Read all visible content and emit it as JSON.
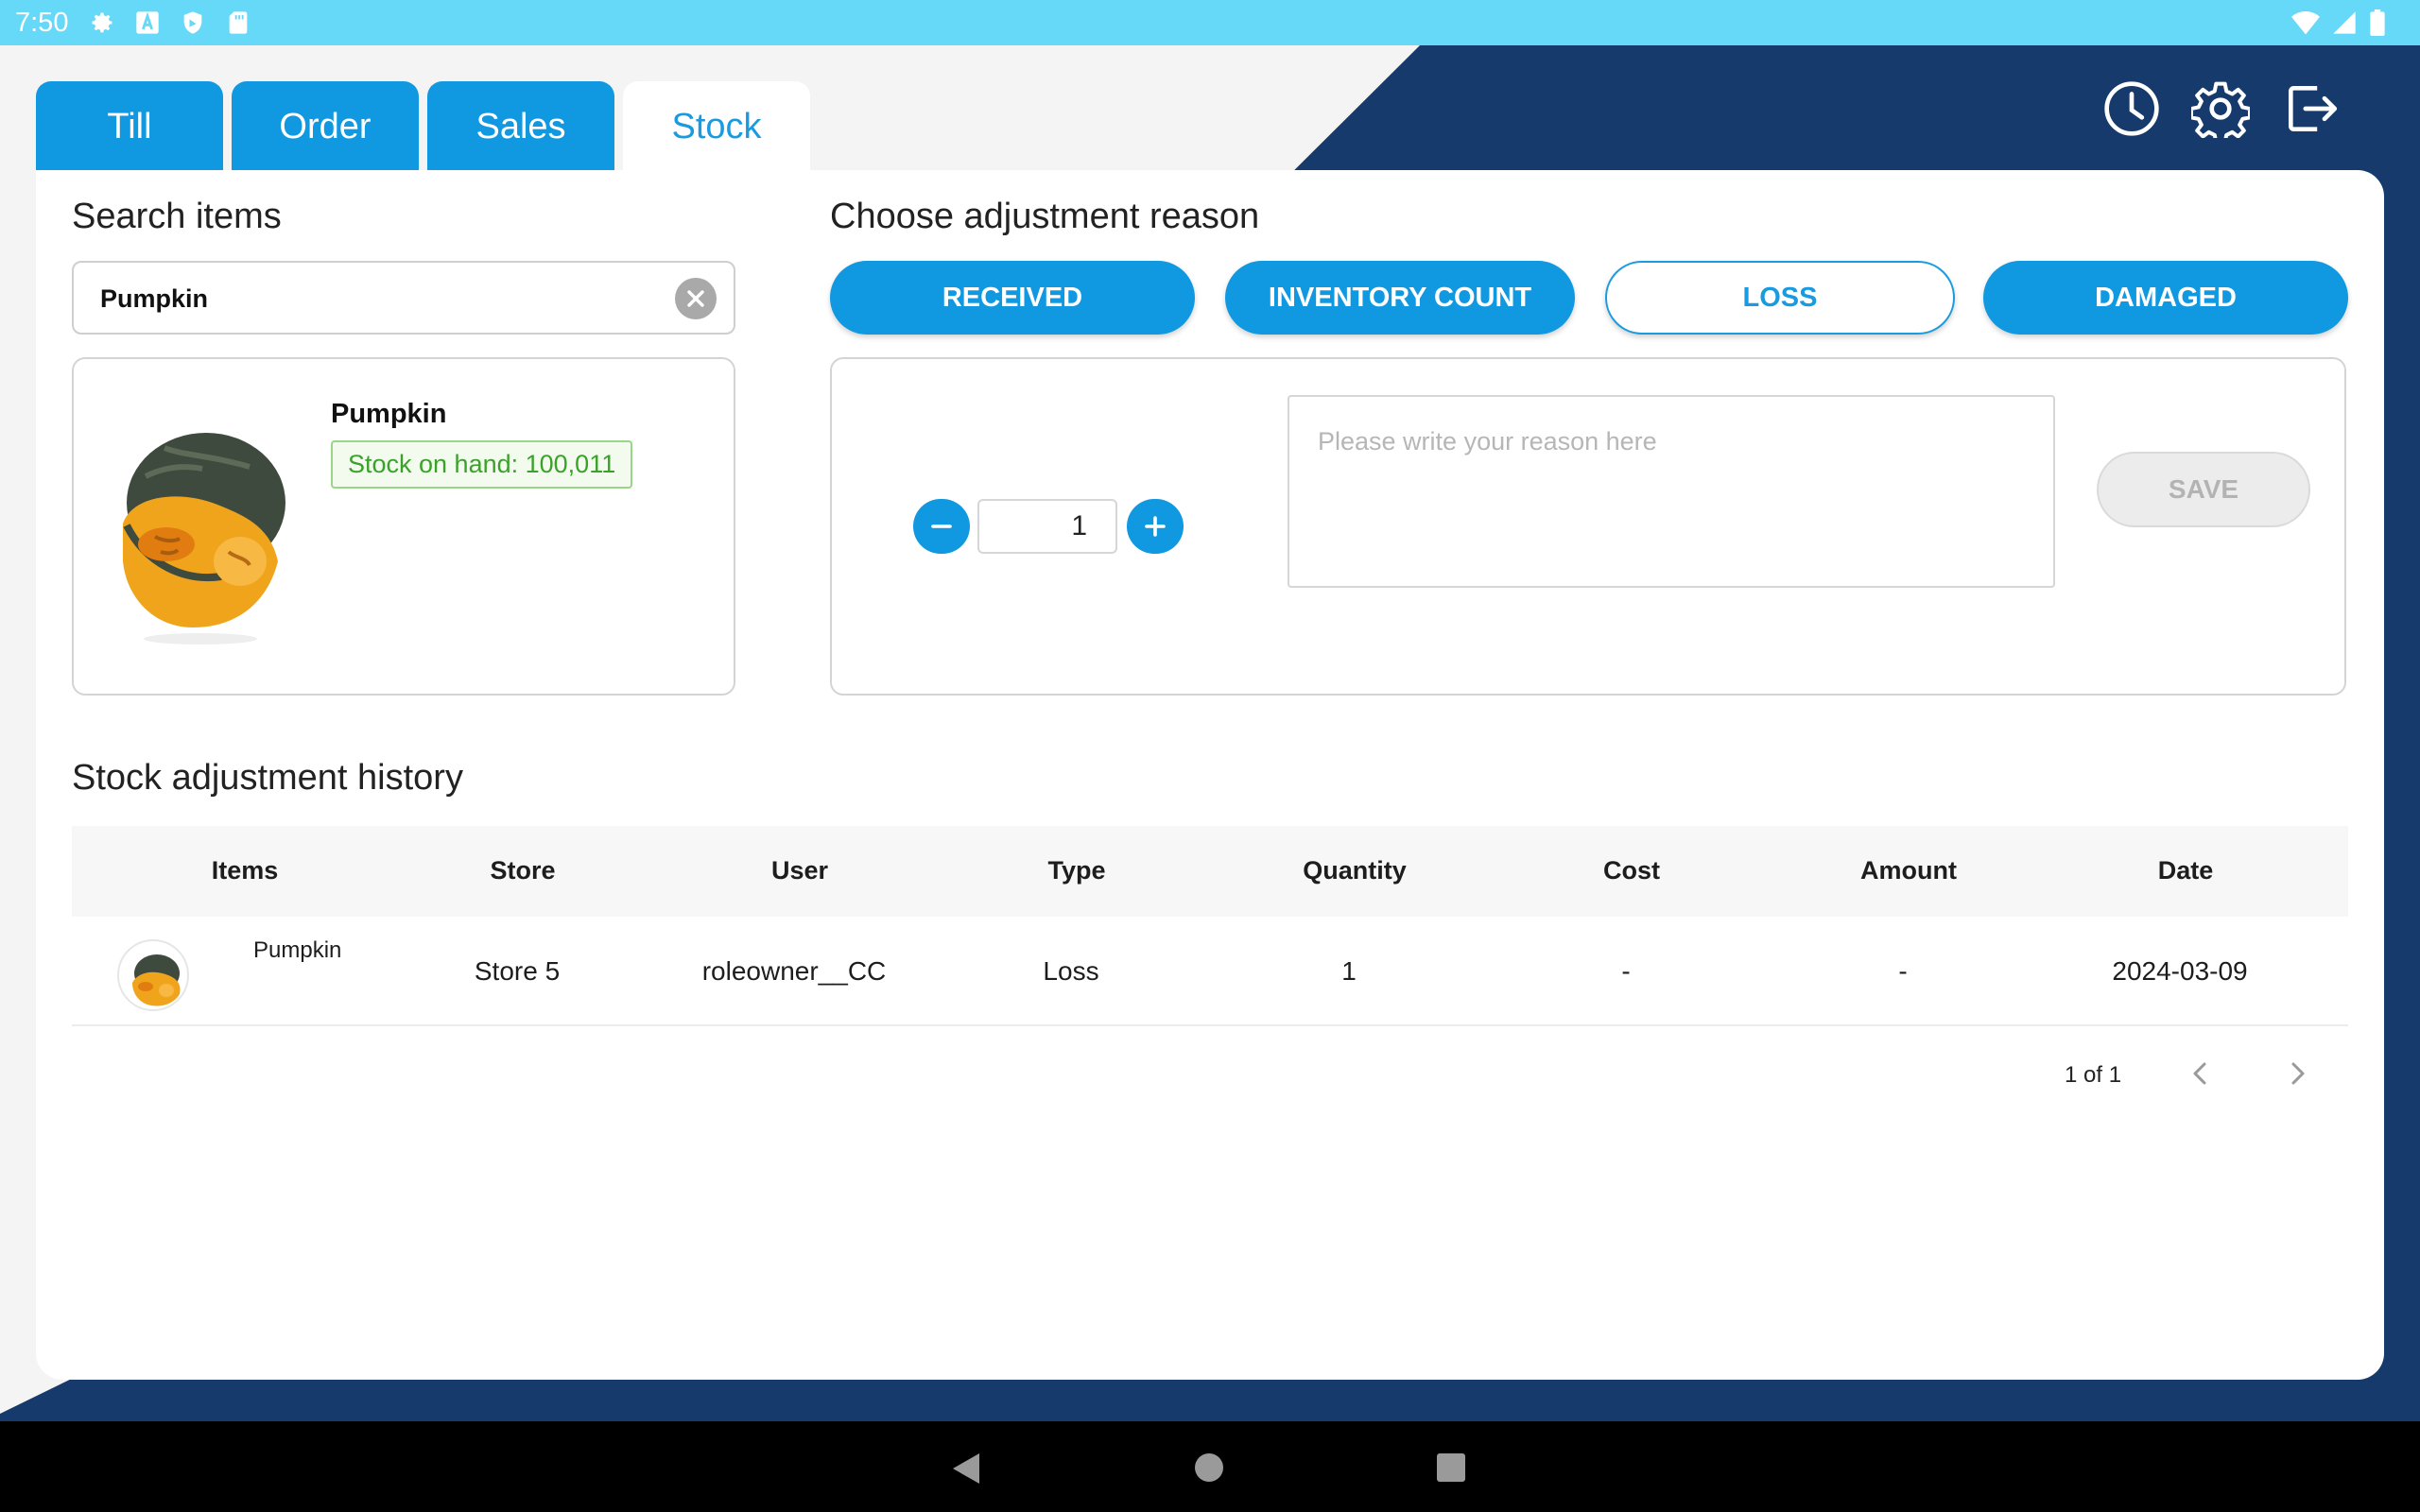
{
  "status_bar": {
    "time": "7:50",
    "icons": [
      "settings-icon",
      "a-badge-icon",
      "shield-icon",
      "sd-card-icon",
      "wifi-icon",
      "signal-icon",
      "battery-icon"
    ]
  },
  "tabs": [
    {
      "label": "Till",
      "active": false
    },
    {
      "label": "Order",
      "active": false
    },
    {
      "label": "Sales",
      "active": false
    },
    {
      "label": "Stock",
      "active": true
    }
  ],
  "toolbar_icons": [
    "history-clock-icon",
    "settings-gear-icon",
    "logout-icon"
  ],
  "search": {
    "title": "Search items",
    "value": "Pumpkin"
  },
  "item": {
    "name": "Pumpkin",
    "stock_label": "Stock on hand: 100,011"
  },
  "adjustment": {
    "title": "Choose adjustment reason",
    "reasons": [
      {
        "label": "RECEIVED",
        "selected": false
      },
      {
        "label": "INVENTORY COUNT",
        "selected": false
      },
      {
        "label": "LOSS",
        "selected": true
      },
      {
        "label": "DAMAGED",
        "selected": false
      }
    ],
    "quantity": "1",
    "reason_placeholder": "Please write your reason here",
    "save_label": "SAVE"
  },
  "history": {
    "title": "Stock adjustment history",
    "columns": [
      "Items",
      "Store",
      "User",
      "Type",
      "Quantity",
      "Cost",
      "Amount",
      "Date"
    ],
    "rows": [
      {
        "item": "Pumpkin",
        "store": "Store 5",
        "user": "roleowner__CC",
        "type": "Loss",
        "quantity": "1",
        "cost": "-",
        "amount": "-",
        "date": "2024-03-09"
      }
    ],
    "pagination": "1 of 1"
  },
  "colors": {
    "primary": "#1098e0",
    "status_bar": "#66d9f8",
    "backdrop": "#153a6b",
    "stock_badge_text": "#3aa22a"
  }
}
